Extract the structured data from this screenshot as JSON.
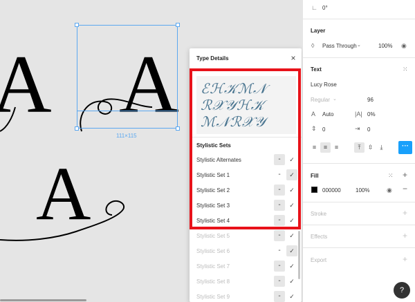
{
  "canvas": {
    "glyph_letter": "A",
    "selection_size": "111×115"
  },
  "dialog": {
    "title": "Type Details",
    "close_icon": "×",
    "preview_rows": [
      "ℰℋ𝒦ℳ𝒩",
      "ℛ𝒳𝒴ℋ𝒦",
      "ℳ𝒩ℛ𝒳𝒴"
    ],
    "section_title": "Stylistic Sets",
    "off_symbol": "-",
    "on_symbol": "✓",
    "sets": [
      {
        "label": "Stylistic Alternates",
        "state": "off",
        "enabled": true
      },
      {
        "label": "Stylistic Set 1",
        "state": "on",
        "enabled": true
      },
      {
        "label": "Stylistic Set 2",
        "state": "off",
        "enabled": true
      },
      {
        "label": "Stylistic Set 3",
        "state": "off",
        "enabled": true
      },
      {
        "label": "Stylistic Set 4",
        "state": "off",
        "enabled": true
      },
      {
        "label": "Stylistic Set 5",
        "state": "off",
        "enabled": false
      },
      {
        "label": "Stylistic Set 6",
        "state": "on",
        "enabled": false
      },
      {
        "label": "Stylistic Set 7",
        "state": "off",
        "enabled": false
      },
      {
        "label": "Stylistic Set 8",
        "state": "off",
        "enabled": false
      },
      {
        "label": "Stylistic Set 9",
        "state": "off",
        "enabled": false
      }
    ]
  },
  "panel": {
    "rotation_value": "0°",
    "layer_title": "Layer",
    "blend_mode": "Pass Through",
    "layer_opacity": "100%",
    "text_title": "Text",
    "font_family": "Lucy Rose",
    "font_weight": "Regular",
    "font_size": "96",
    "line_height": "Auto",
    "letter_spacing": "0%",
    "paragraph_spacing": "0",
    "paragraph_indent": "0",
    "fill_title": "Fill",
    "fill_hex": "000000",
    "fill_opacity": "100%",
    "stroke_title": "Stroke",
    "effects_title": "Effects",
    "export_title": "Export",
    "help_label": "?",
    "colors": {
      "accent": "#18a0fb",
      "highlight": "#e8121a",
      "preview_text": "#4a7590"
    }
  }
}
